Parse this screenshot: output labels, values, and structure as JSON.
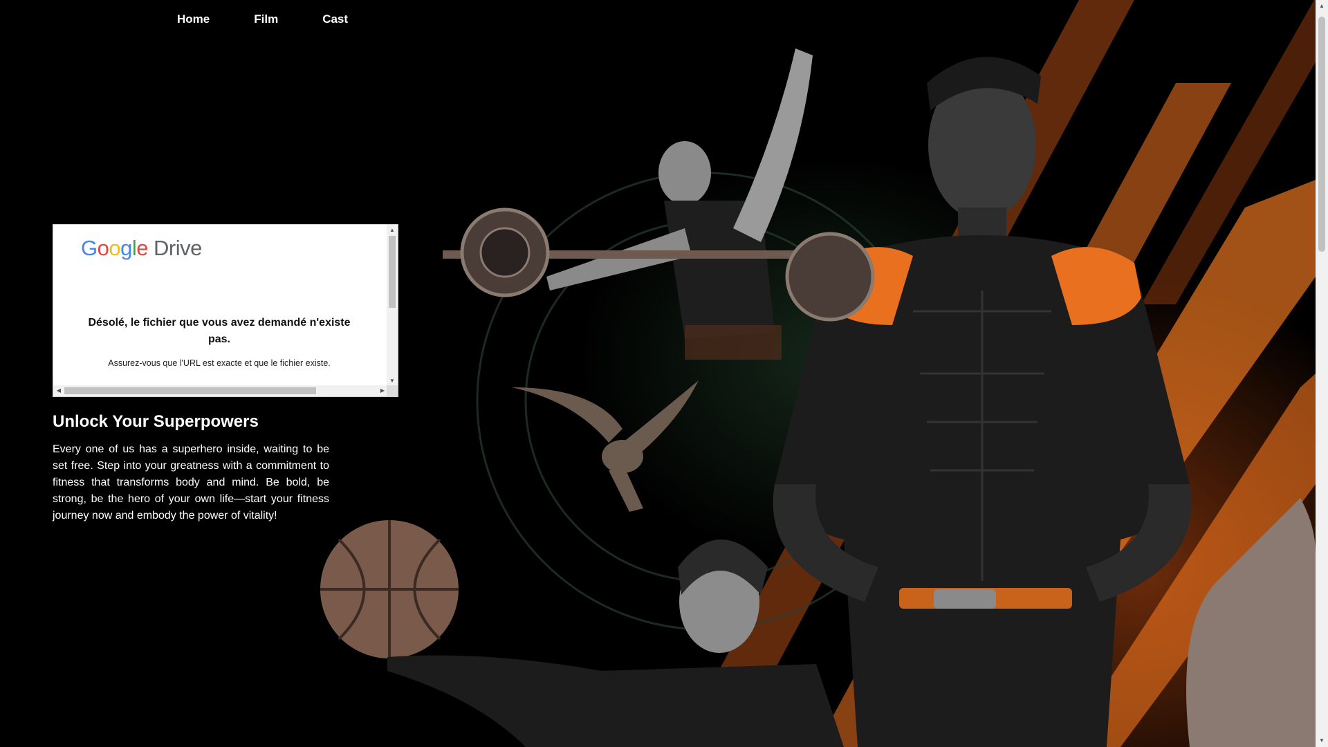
{
  "nav": {
    "items": [
      {
        "label": "Home"
      },
      {
        "label": "Film"
      },
      {
        "label": "Cast"
      }
    ]
  },
  "drive_embed": {
    "logo": {
      "google": [
        "G",
        "o",
        "o",
        "g",
        "l",
        "e"
      ],
      "product": "Drive"
    },
    "error_title": "Désolé, le fichier que vous avez demandé n'existe pas.",
    "error_subtitle": "Assurez-vous que l'URL est exacte et que le fichier existe."
  },
  "promo": {
    "heading": "Unlock Your Superpowers",
    "body": "Every one of us has a superhero inside, waiting to be set free. Step into your greatness with a commitment to fitness that transforms body and mind. Be bold, be strong, be the hero of your own life—start your fitness journey now and embody the power of vitality!"
  },
  "colors": {
    "background": "#000000",
    "accent_orange": "#E8701E",
    "google_blue": "#4285F4",
    "google_red": "#EA4335",
    "google_yellow": "#FBBC05",
    "google_green": "#34A853",
    "drive_gray": "#5f6368"
  },
  "icons": {
    "scroll_up": "triangle-up-icon",
    "scroll_down": "triangle-down-icon",
    "scroll_left": "triangle-left-icon",
    "scroll_right": "triangle-right-icon"
  }
}
